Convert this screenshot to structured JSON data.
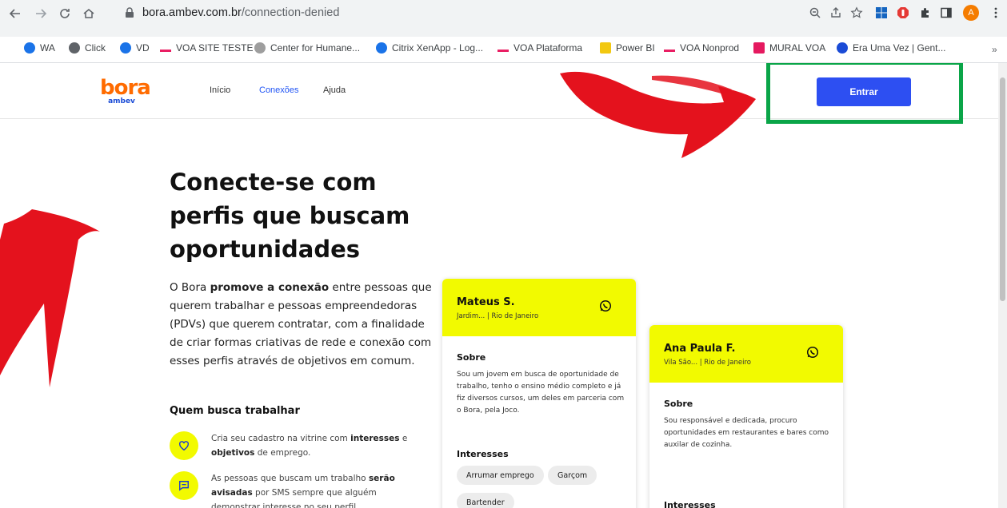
{
  "browser": {
    "url_host": "bora.ambev.com.br",
    "url_path": "/connection-denied",
    "profile_initial": "A",
    "bookmarks": [
      {
        "label": "WA",
        "icon": "whatsapp-icon",
        "color": "#1a73e8"
      },
      {
        "label": "Click",
        "icon": "globe-icon",
        "color": "#5f6368"
      },
      {
        "label": "VD",
        "icon": "citrix-icon",
        "color": "#1a73e8"
      },
      {
        "label": "VOA SITE TESTE",
        "icon": "voa-icon",
        "color": "#e91e63"
      },
      {
        "label": "Center for Humane...",
        "icon": "humane-icon",
        "color": "#9e9e9e"
      },
      {
        "label": "Citrix XenApp - Log...",
        "icon": "citrix-icon",
        "color": "#1a73e8"
      },
      {
        "label": "VOA Plataforma",
        "icon": "voa-icon",
        "color": "#e91e63"
      },
      {
        "label": "Power BI",
        "icon": "powerbi-icon",
        "color": "#f2c811"
      },
      {
        "label": "VOA Nonprod",
        "icon": "voa-icon",
        "color": "#e91e63"
      },
      {
        "label": "MURAL VOA",
        "icon": "mural-icon",
        "color": "#e5195f"
      },
      {
        "label": "Era Uma Vez | Gent...",
        "icon": "g-icon",
        "color": "#1a4bd6"
      }
    ],
    "more": "»"
  },
  "site": {
    "logo_word": "bora",
    "logo_sub": "ambev",
    "nav": [
      {
        "label": "Início",
        "active": false
      },
      {
        "label": "Conexões",
        "active": true
      },
      {
        "label": "Ajuda",
        "active": false
      }
    ],
    "enter_label": "Entrar"
  },
  "hero": {
    "title_lines": [
      "Conecte-se com",
      "perfis que buscam",
      "oportunidades"
    ],
    "desc_1": "O Bora ",
    "desc_bold": "promove a conexão",
    "desc_2": " entre pessoas que querem trabalhar e pessoas empreendedoras (PDVs) que querem contratar, com a finalidade de criar formas criativas de rede e conexão com esses perfis através de objetivos em comum."
  },
  "workers": {
    "title": "Quem busca trabalhar",
    "feature_1": {
      "a": "Cria seu cadastro na vitrine com ",
      "b": "interesses",
      "c": " e ",
      "d": "objetivos",
      "e": " de emprego."
    },
    "feature_2": {
      "a": "As pessoas que buscam um trabalho ",
      "b": "serão avisadas",
      "c": " por SMS sempre que alguém demonstrar interesse no seu perfil."
    }
  },
  "cards": [
    {
      "name": "Mateus S.",
      "location": "Jardim... | Rio de Janeiro",
      "about_label": "Sobre",
      "about": "Sou um jovem em busca de oportunidade de trabalho, tenho o ensino médio completo e já fiz diversos cursos, um deles em parceria com o Bora, pela Joco.",
      "interests_label": "Interesses",
      "interests": [
        "Arrumar emprego",
        "Garçom",
        "Bartender"
      ]
    },
    {
      "name": "Ana Paula F.",
      "location": "Vila São... | Rio de Janeiro",
      "about_label": "Sobre",
      "about": "Sou responsável e dedicada, procuro oportunidades em restaurantes e bares como auxilar de cozinha.",
      "interests_label": "Interesses",
      "interests": []
    }
  ],
  "colors": {
    "accent_blue": "#2d4ff2",
    "brand_orange": "#ff6b00",
    "card_yellow": "#f2fa00",
    "highlight_green": "#0aa548",
    "arrow_red": "#e4121d"
  }
}
